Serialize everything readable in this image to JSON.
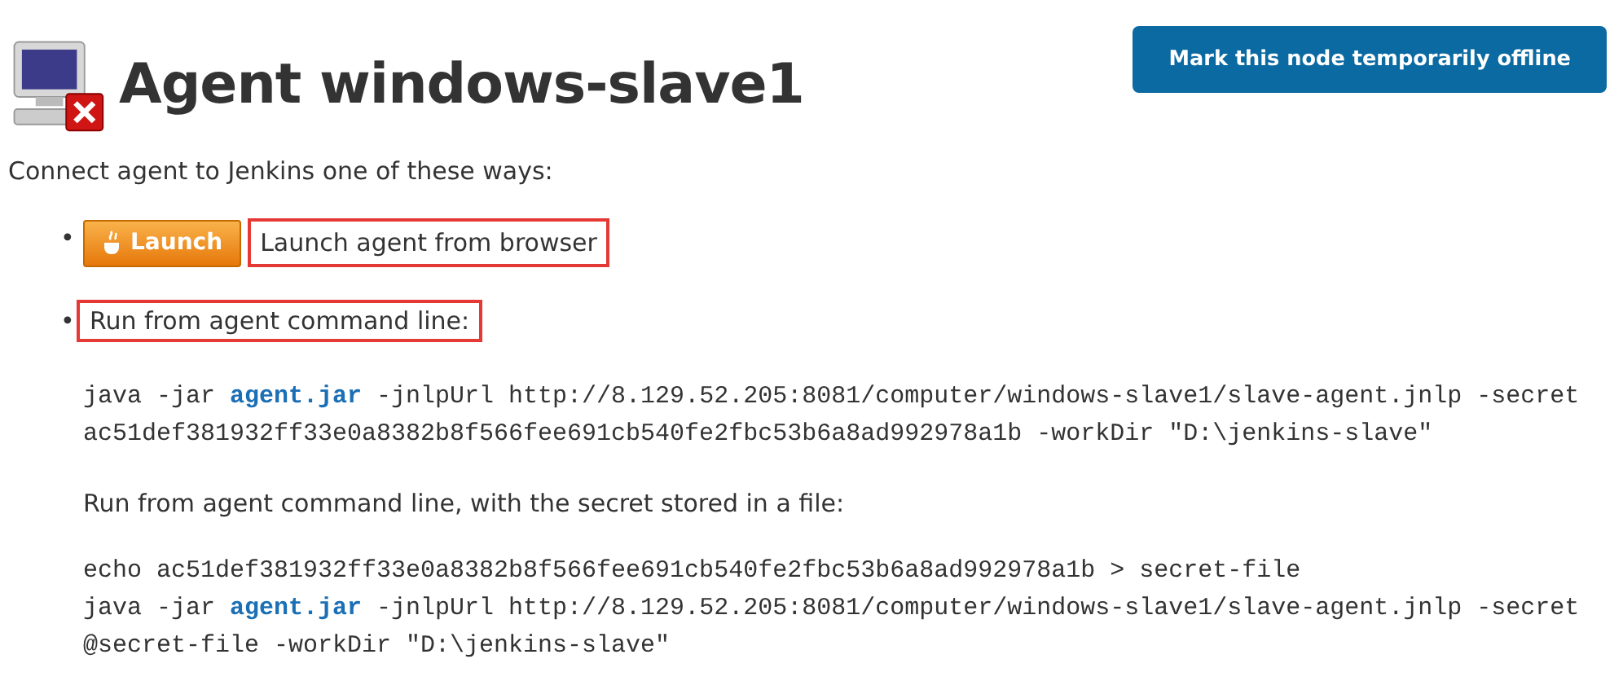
{
  "header": {
    "title": "Agent windows-slave1",
    "offline": true
  },
  "offline_button": "Mark this node temporarily offline",
  "intro": "Connect agent to Jenkins one of these ways:",
  "methods": [
    {
      "kind": "launch",
      "bullet": "•",
      "button": "Launch",
      "label": "Launch agent from browser",
      "highlighted": true
    },
    {
      "kind": "command",
      "bullet": "•",
      "label": "Run from agent command line:",
      "highlighted": true,
      "command_lines": [
        [
          {
            "kind": "text",
            "text": "java -jar "
          },
          {
            "kind": "link",
            "text": "agent.jar"
          },
          {
            "kind": "text",
            "text": " -jnlpUrl http://8.129.52.205:8081/computer/windows-slave1/slave-agent.jnlp -secret"
          }
        ],
        [
          {
            "kind": "text",
            "text": "ac51def381932ff33e0a8382b8f566fee691cb540fe2fbc53b6a8ad992978a1b -workDir \"D:\\jenkins-slave\""
          }
        ]
      ],
      "secret_file_label": "Run from agent command line, with the secret stored in a file:",
      "secret_file_lines": [
        [
          {
            "kind": "text",
            "text": "echo ac51def381932ff33e0a8382b8f566fee691cb540fe2fbc53b6a8ad992978a1b > secret-file"
          }
        ],
        [
          {
            "kind": "text",
            "text": "java -jar "
          },
          {
            "kind": "link",
            "text": "agent.jar"
          },
          {
            "kind": "text",
            "text": " -jnlpUrl http://8.129.52.205:8081/computer/windows-slave1/slave-agent.jnlp -secret"
          }
        ],
        [
          {
            "kind": "text",
            "text": "@secret-file -workDir \"D:\\jenkins-slave\""
          }
        ]
      ]
    }
  ]
}
